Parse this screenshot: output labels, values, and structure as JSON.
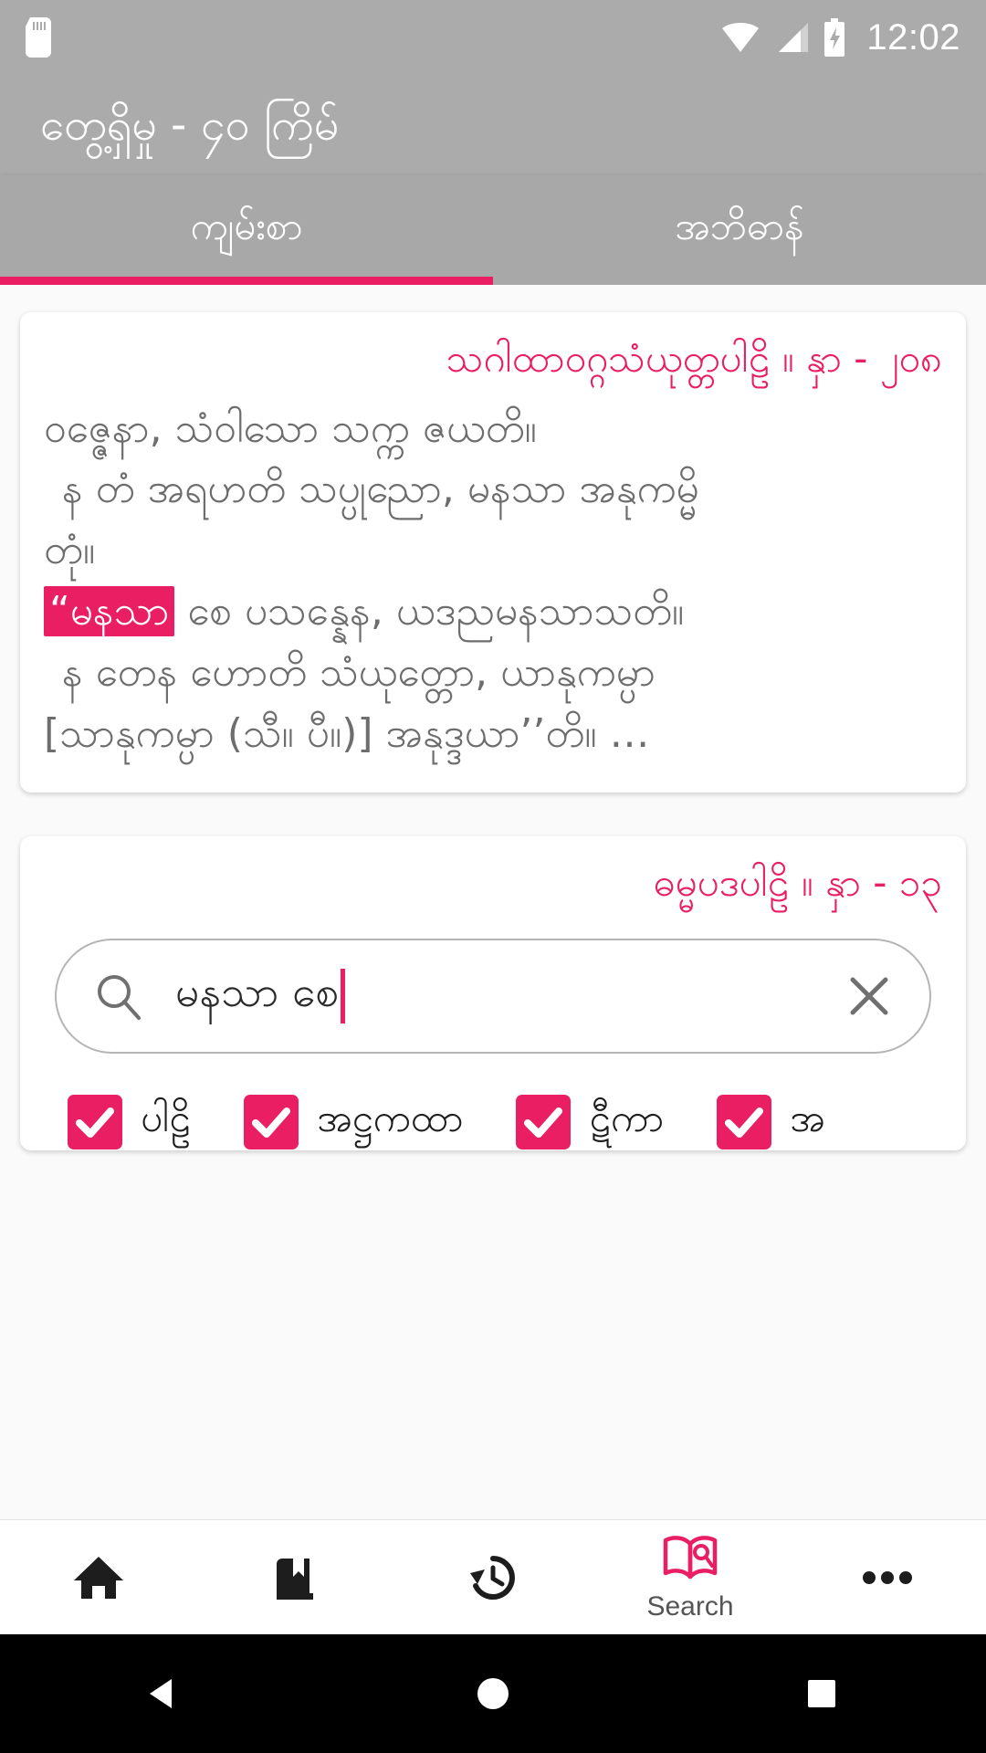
{
  "statusbar": {
    "clock": "12:02",
    "icons": [
      "sd-card-icon",
      "wifi-icon",
      "signal-icon",
      "battery-charging-icon"
    ]
  },
  "appbar": {
    "title": "တွေ့ရှိမှု - ၄၀ ကြိမ်"
  },
  "tabs": [
    {
      "label": "ကျမ်းစာ",
      "selected": true
    },
    {
      "label": "အဘိဓာန်",
      "selected": false
    }
  ],
  "results": [
    {
      "header": "သဂါထာဝဂ္ဂသံယုတ္တပါဠိ ။ နှာ - ၂၀၈",
      "lines": [
        {
          "text": "ဝဇ္ဇေနာ, သံဝါသော သက္က ဇယတိ။",
          "indent": false,
          "highlight": null
        },
        {
          "text": "န တံ အရဟတိ သပ္ပုညော, မနသာ အနုကမ္မိ",
          "indent": true,
          "highlight": null
        },
        {
          "text": "တုံ။",
          "indent": false,
          "highlight": null
        },
        {
          "text": "“မနသာ",
          "indent": false,
          "highlight": "“မနသာ",
          "after": " စေ ပသန္နေန, ယဒညမနသာသတိ။"
        },
        {
          "text": "န တေန ဟောတိ သံယုတ္တော, ယာနုကမ္ပာ",
          "indent": true,
          "highlight": null
        },
        {
          "text": "[သာနုကမ္ပာ (သီ။ ပီ။)] အနုဒ္ဒယာ’’တိ။ …",
          "indent": false,
          "highlight": null
        }
      ]
    },
    {
      "header": "ဓမ္မပဒပါဠိ ။ နှာ - ၁၃"
    }
  ],
  "search": {
    "value": "မနသာ စေ",
    "placeholder": "",
    "search_icon": "search-icon",
    "clear_icon": "close-icon"
  },
  "filters": [
    {
      "label": "ပါဠိ",
      "checked": true
    },
    {
      "label": "အဋ္ဌကထာ",
      "checked": true
    },
    {
      "label": "ဋီကာ",
      "checked": true
    },
    {
      "label": "အ",
      "checked": true
    }
  ],
  "bottomnav": [
    {
      "icon": "home-icon",
      "label": "",
      "active": false
    },
    {
      "icon": "bookmark-book-icon",
      "label": "",
      "active": false
    },
    {
      "icon": "history-icon",
      "label": "",
      "active": false
    },
    {
      "icon": "book-search-icon",
      "label": "Search",
      "active": true
    },
    {
      "icon": "more-horizontal-icon",
      "label": "",
      "active": false
    }
  ],
  "sysnav": [
    "back-icon",
    "home-circle-icon",
    "recents-square-icon"
  ],
  "colors": {
    "accent": "#e91e63",
    "appbar": "#ababab",
    "tabbar": "#a8a8a8",
    "body_text": "#6d6d6d",
    "page_bg": "#fafafa"
  }
}
